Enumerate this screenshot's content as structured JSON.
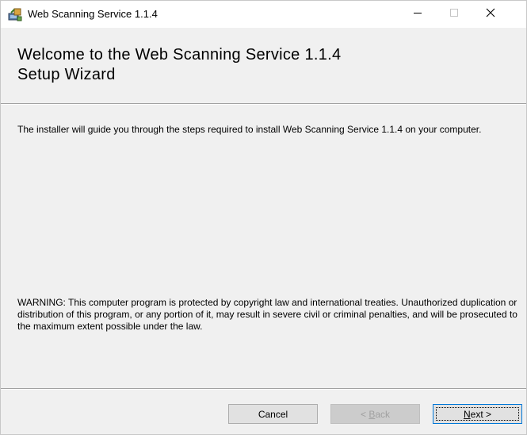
{
  "window": {
    "title": "Web Scanning Service 1.1.4"
  },
  "titlebar": {
    "icons": {
      "app": "installer-icon",
      "minimize": "minimize-icon",
      "maximize": "maximize-icon",
      "close": "close-icon"
    }
  },
  "header": {
    "heading_line1": "Welcome to the Web Scanning Service 1.1.4",
    "heading_line2": "Setup Wizard"
  },
  "body": {
    "intro": "The installer will guide you through the steps required to install Web Scanning Service 1.1.4 on your computer.",
    "warning": "WARNING: This computer program is protected by copyright law and international treaties. Unauthorized duplication or distribution of this program, or any portion of it, may result in severe civil or criminal penalties, and will be prosecuted to the maximum extent possible under the law."
  },
  "buttons": {
    "cancel": "Cancel",
    "back_prefix": "< ",
    "back_accel": "B",
    "back_rest": "ack",
    "next_accel": "N",
    "next_rest": "ext >",
    "back_enabled": false
  },
  "colors": {
    "window_bg": "#f0f0f0",
    "titlebar_bg": "#ffffff",
    "focus_border": "#0078d7",
    "disabled_text": "#a0a0a0"
  }
}
